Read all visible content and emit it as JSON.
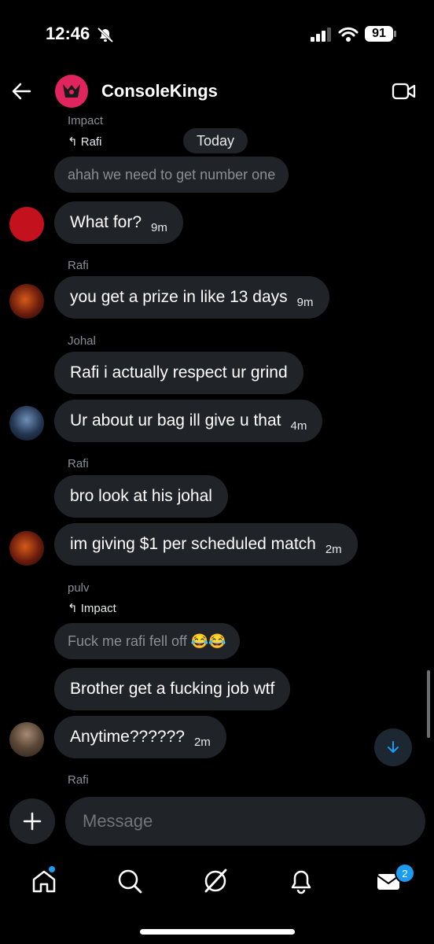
{
  "status": {
    "time": "12:46",
    "battery": "91"
  },
  "header": {
    "title": "ConsoleKings"
  },
  "date_divider": "Today",
  "messages": [
    {
      "sender": "Impact",
      "reply_to": "Rafi",
      "text": "ahah we need to get number one"
    },
    {
      "text": "What for?",
      "time": "9m"
    },
    {
      "sender": "Rafi",
      "text": "you get a prize in like 13 days",
      "time": "9m"
    },
    {
      "sender": "Johal",
      "text": "Rafi i actually respect ur grind"
    },
    {
      "text": "Ur about ur bag ill give u that",
      "time": "4m"
    },
    {
      "sender": "Rafi",
      "text": "bro look at his johal"
    },
    {
      "text": "im giving $1 per scheduled match",
      "time": "2m"
    },
    {
      "sender": "pulv",
      "reply_to": "Impact",
      "text": "Fuck me rafi fell off 😂😂"
    },
    {
      "text": "Brother get a fucking job wtf"
    },
    {
      "text": "Anytime??????",
      "time": "2m"
    },
    {
      "sender": "Rafi"
    }
  ],
  "composer": {
    "placeholder": "Message"
  },
  "nav": {
    "messages_badge": "2"
  },
  "colors": {
    "accent": "#1d9bf0",
    "bubble": "#202327",
    "secondary_text": "#8b8f94"
  }
}
